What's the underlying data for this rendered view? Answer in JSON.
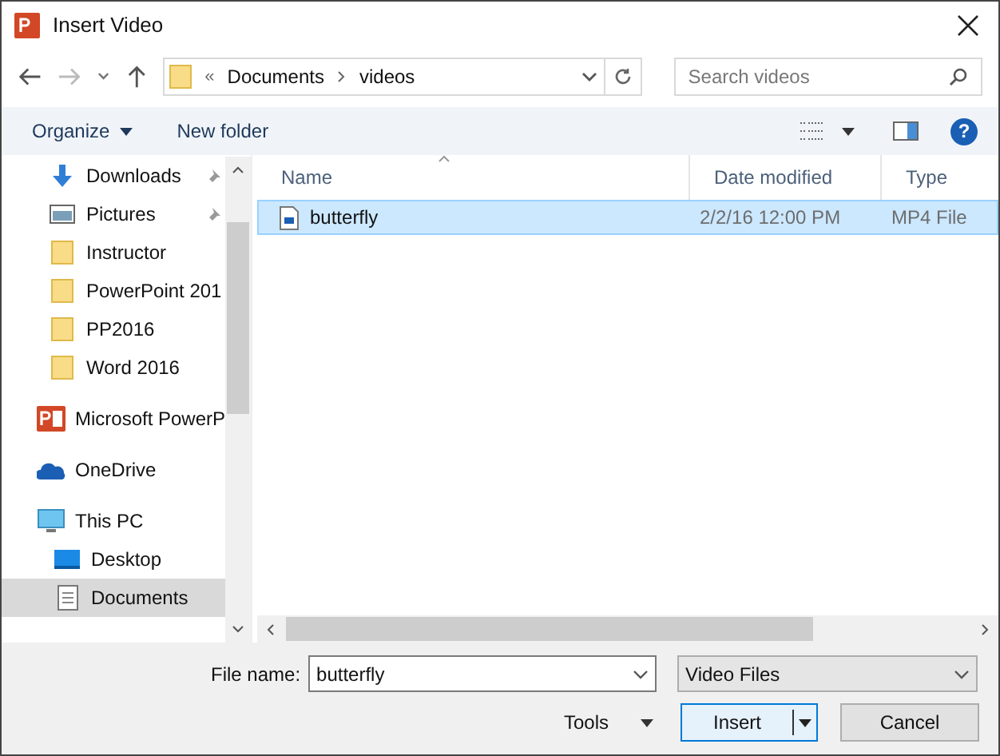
{
  "window": {
    "title": "Insert Video"
  },
  "address": {
    "overflow": "«",
    "path": [
      "Documents",
      "videos"
    ]
  },
  "search": {
    "placeholder": "Search videos"
  },
  "toolbar": {
    "organize": "Organize",
    "new_folder": "New folder",
    "help": "?"
  },
  "quick_access_items": [
    {
      "label": "Downloads",
      "kind": "downloads",
      "pinned": true,
      "selected": false
    },
    {
      "label": "Pictures",
      "kind": "pictures",
      "pinned": true,
      "selected": false
    },
    {
      "label": "Instructor",
      "kind": "folder",
      "pinned": false,
      "selected": false
    },
    {
      "label": "PowerPoint 201",
      "kind": "folder",
      "pinned": false,
      "selected": false
    },
    {
      "label": "PP2016",
      "kind": "folder",
      "pinned": false,
      "selected": false
    },
    {
      "label": "Word 2016",
      "kind": "folder",
      "pinned": false,
      "selected": false
    }
  ],
  "nav_items": [
    {
      "label": "Microsoft PowerP",
      "kind": "app",
      "selected": false
    },
    {
      "label": "OneDrive",
      "kind": "onedrive",
      "selected": false
    },
    {
      "label": "This PC",
      "kind": "pc",
      "selected": false,
      "children": [
        {
          "label": "Desktop",
          "kind": "desktop",
          "selected": false
        },
        {
          "label": "Documents",
          "kind": "documents",
          "selected": true
        }
      ]
    }
  ],
  "table": {
    "columns": [
      "Name",
      "Date modified",
      "Type"
    ],
    "rows": [
      {
        "name": "butterfly",
        "date": "2/2/16 12:00 PM",
        "type": "MP4 File",
        "selected": true
      }
    ]
  },
  "footer": {
    "file_name_label": "File name:",
    "file_name": "butterfly",
    "filter": "Video Files",
    "tools": "Tools",
    "insert": "Insert",
    "cancel": "Cancel"
  }
}
